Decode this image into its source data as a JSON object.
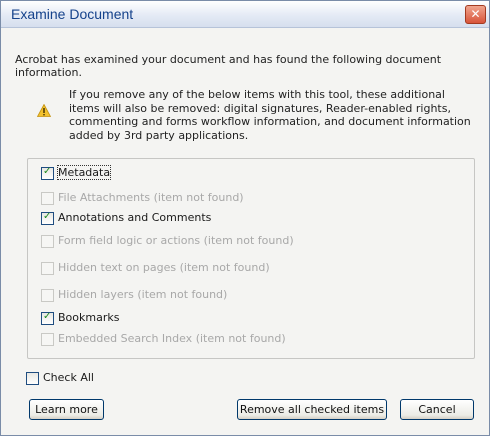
{
  "dialog": {
    "title": "Examine Document",
    "close_icon": "close-icon",
    "intro": "Acrobat has examined your document and has found the following document information.",
    "warning_icon": "warning-icon",
    "warning_text": "If you remove any of the below items with this tool, these additional items will also be removed: digital signatures, Reader-enabled rights, commenting and forms workflow information, and document information added by 3rd party applications.",
    "items": [
      {
        "label": "Metadata",
        "checked": true,
        "enabled": true
      },
      {
        "label": "File Attachments (item not found)",
        "checked": false,
        "enabled": false
      },
      {
        "label": "Annotations and Comments",
        "checked": true,
        "enabled": true
      },
      {
        "label": "Form field logic or actions (item not found)",
        "checked": false,
        "enabled": false
      },
      {
        "label": "Hidden text on pages (item not found)",
        "checked": false,
        "enabled": false
      },
      {
        "label": "Hidden layers (item not found)",
        "checked": false,
        "enabled": false
      },
      {
        "label": "Bookmarks",
        "checked": true,
        "enabled": true
      },
      {
        "label": "Embedded Search Index (item not found)",
        "checked": false,
        "enabled": false
      }
    ],
    "check_all": {
      "label": "Check All",
      "checked": false
    },
    "buttons": {
      "learn_more": "Learn more",
      "remove_checked": "Remove all checked items",
      "cancel": "Cancel"
    }
  }
}
